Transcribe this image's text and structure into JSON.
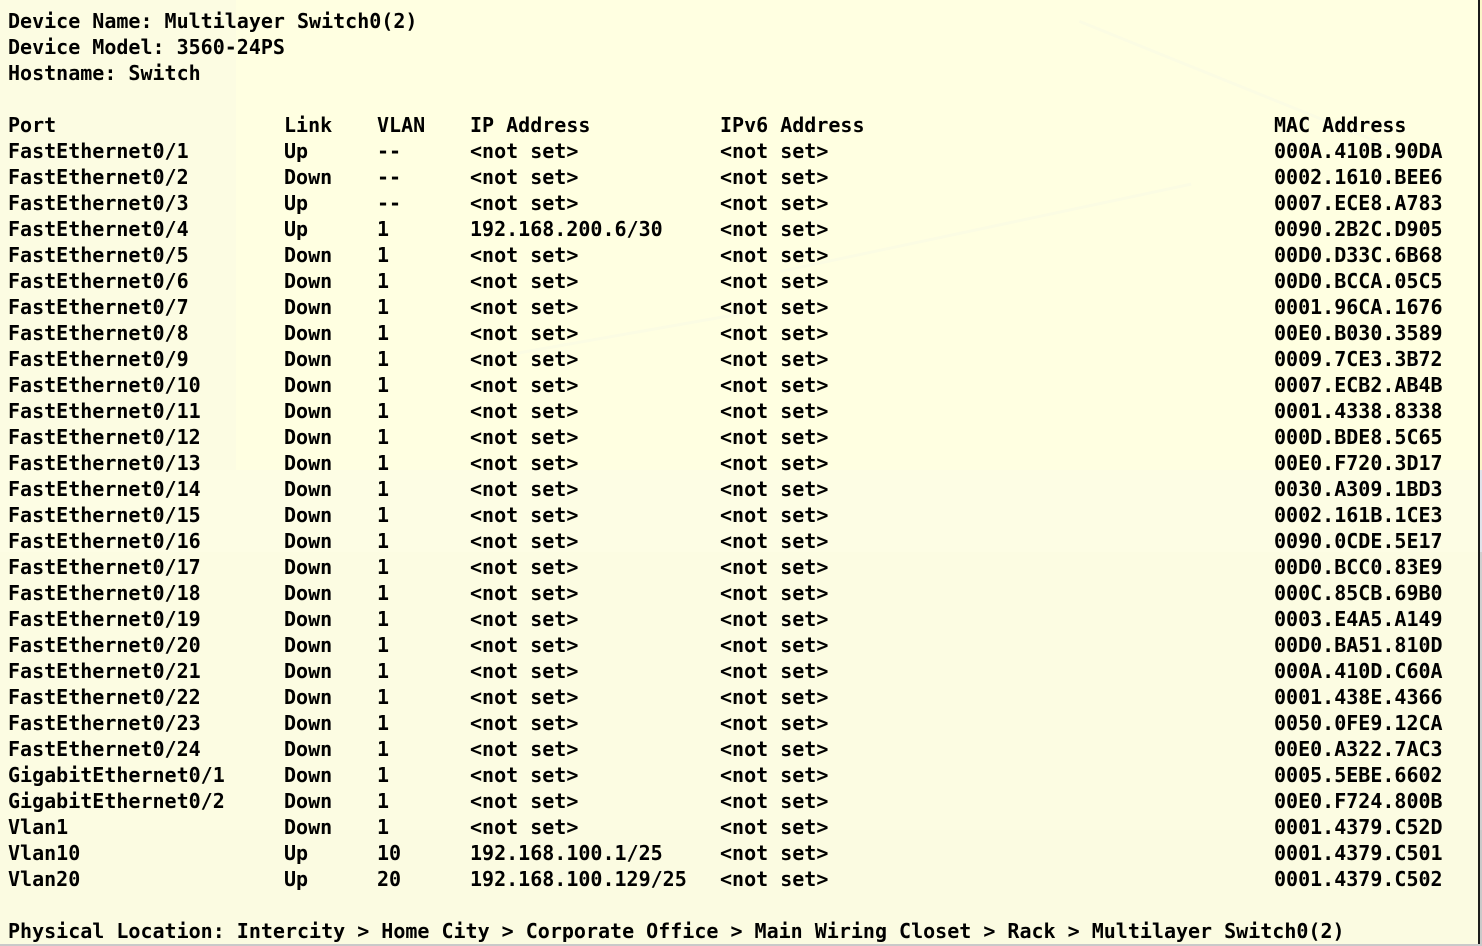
{
  "device": {
    "name_label": "Device Name: Multilayer Switch0(2)",
    "model_label": "Device Model: 3560-24PS",
    "hostname_label": "Hostname: Switch"
  },
  "table": {
    "headers": {
      "port": "Port",
      "link": "Link",
      "vlan": "VLAN",
      "ip": "IP Address",
      "ipv6": "IPv6 Address",
      "mac": "MAC Address"
    },
    "rows": [
      {
        "port": "FastEthernet0/1",
        "link": "Up",
        "vlan": "--",
        "ip": "<not set>",
        "ipv6": "<not set>",
        "mac": "000A.410B.90DA"
      },
      {
        "port": "FastEthernet0/2",
        "link": "Down",
        "vlan": "--",
        "ip": "<not set>",
        "ipv6": "<not set>",
        "mac": "0002.1610.BEE6"
      },
      {
        "port": "FastEthernet0/3",
        "link": "Up",
        "vlan": "--",
        "ip": "<not set>",
        "ipv6": "<not set>",
        "mac": "0007.ECE8.A783"
      },
      {
        "port": "FastEthernet0/4",
        "link": "Up",
        "vlan": "1",
        "ip": "192.168.200.6/30",
        "ipv6": "<not set>",
        "mac": "0090.2B2C.D905"
      },
      {
        "port": "FastEthernet0/5",
        "link": "Down",
        "vlan": "1",
        "ip": "<not set>",
        "ipv6": "<not set>",
        "mac": "00D0.D33C.6B68"
      },
      {
        "port": "FastEthernet0/6",
        "link": "Down",
        "vlan": "1",
        "ip": "<not set>",
        "ipv6": "<not set>",
        "mac": "00D0.BCCA.05C5"
      },
      {
        "port": "FastEthernet0/7",
        "link": "Down",
        "vlan": "1",
        "ip": "<not set>",
        "ipv6": "<not set>",
        "mac": "0001.96CA.1676"
      },
      {
        "port": "FastEthernet0/8",
        "link": "Down",
        "vlan": "1",
        "ip": "<not set>",
        "ipv6": "<not set>",
        "mac": "00E0.B030.3589"
      },
      {
        "port": "FastEthernet0/9",
        "link": "Down",
        "vlan": "1",
        "ip": "<not set>",
        "ipv6": "<not set>",
        "mac": "0009.7CE3.3B72"
      },
      {
        "port": "FastEthernet0/10",
        "link": "Down",
        "vlan": "1",
        "ip": "<not set>",
        "ipv6": "<not set>",
        "mac": "0007.ECB2.AB4B"
      },
      {
        "port": "FastEthernet0/11",
        "link": "Down",
        "vlan": "1",
        "ip": "<not set>",
        "ipv6": "<not set>",
        "mac": "0001.4338.8338"
      },
      {
        "port": "FastEthernet0/12",
        "link": "Down",
        "vlan": "1",
        "ip": "<not set>",
        "ipv6": "<not set>",
        "mac": "000D.BDE8.5C65"
      },
      {
        "port": "FastEthernet0/13",
        "link": "Down",
        "vlan": "1",
        "ip": "<not set>",
        "ipv6": "<not set>",
        "mac": "00E0.F720.3D17"
      },
      {
        "port": "FastEthernet0/14",
        "link": "Down",
        "vlan": "1",
        "ip": "<not set>",
        "ipv6": "<not set>",
        "mac": "0030.A309.1BD3"
      },
      {
        "port": "FastEthernet0/15",
        "link": "Down",
        "vlan": "1",
        "ip": "<not set>",
        "ipv6": "<not set>",
        "mac": "0002.161B.1CE3"
      },
      {
        "port": "FastEthernet0/16",
        "link": "Down",
        "vlan": "1",
        "ip": "<not set>",
        "ipv6": "<not set>",
        "mac": "0090.0CDE.5E17"
      },
      {
        "port": "FastEthernet0/17",
        "link": "Down",
        "vlan": "1",
        "ip": "<not set>",
        "ipv6": "<not set>",
        "mac": "00D0.BCC0.83E9"
      },
      {
        "port": "FastEthernet0/18",
        "link": "Down",
        "vlan": "1",
        "ip": "<not set>",
        "ipv6": "<not set>",
        "mac": "000C.85CB.69B0"
      },
      {
        "port": "FastEthernet0/19",
        "link": "Down",
        "vlan": "1",
        "ip": "<not set>",
        "ipv6": "<not set>",
        "mac": "0003.E4A5.A149"
      },
      {
        "port": "FastEthernet0/20",
        "link": "Down",
        "vlan": "1",
        "ip": "<not set>",
        "ipv6": "<not set>",
        "mac": "00D0.BA51.810D"
      },
      {
        "port": "FastEthernet0/21",
        "link": "Down",
        "vlan": "1",
        "ip": "<not set>",
        "ipv6": "<not set>",
        "mac": "000A.410D.C60A"
      },
      {
        "port": "FastEthernet0/22",
        "link": "Down",
        "vlan": "1",
        "ip": "<not set>",
        "ipv6": "<not set>",
        "mac": "0001.438E.4366"
      },
      {
        "port": "FastEthernet0/23",
        "link": "Down",
        "vlan": "1",
        "ip": "<not set>",
        "ipv6": "<not set>",
        "mac": "0050.0FE9.12CA"
      },
      {
        "port": "FastEthernet0/24",
        "link": "Down",
        "vlan": "1",
        "ip": "<not set>",
        "ipv6": "<not set>",
        "mac": "00E0.A322.7AC3"
      },
      {
        "port": "GigabitEthernet0/1",
        "link": "Down",
        "vlan": "1",
        "ip": "<not set>",
        "ipv6": "<not set>",
        "mac": "0005.5EBE.6602"
      },
      {
        "port": "GigabitEthernet0/2",
        "link": "Down",
        "vlan": "1",
        "ip": "<not set>",
        "ipv6": "<not set>",
        "mac": "00E0.F724.800B"
      },
      {
        "port": "Vlan1",
        "link": "Down",
        "vlan": "1",
        "ip": "<not set>",
        "ipv6": "<not set>",
        "mac": "0001.4379.C52D"
      },
      {
        "port": "Vlan10",
        "link": "Up",
        "vlan": "10",
        "ip": "192.168.100.1/25",
        "ipv6": "<not set>",
        "mac": "0001.4379.C501"
      },
      {
        "port": "Vlan20",
        "link": "Up",
        "vlan": "20",
        "ip": "192.168.100.129/25",
        "ipv6": "<not set>",
        "mac": "0001.4379.C502"
      }
    ]
  },
  "location": "Physical Location: Intercity > Home City > Corporate Office > Main Wiring Closet > Rack > Multilayer Switch0(2)",
  "colors": {
    "tooltip_background": "#ffffe3",
    "text": "#000000",
    "border": "#1b1b1b"
  }
}
